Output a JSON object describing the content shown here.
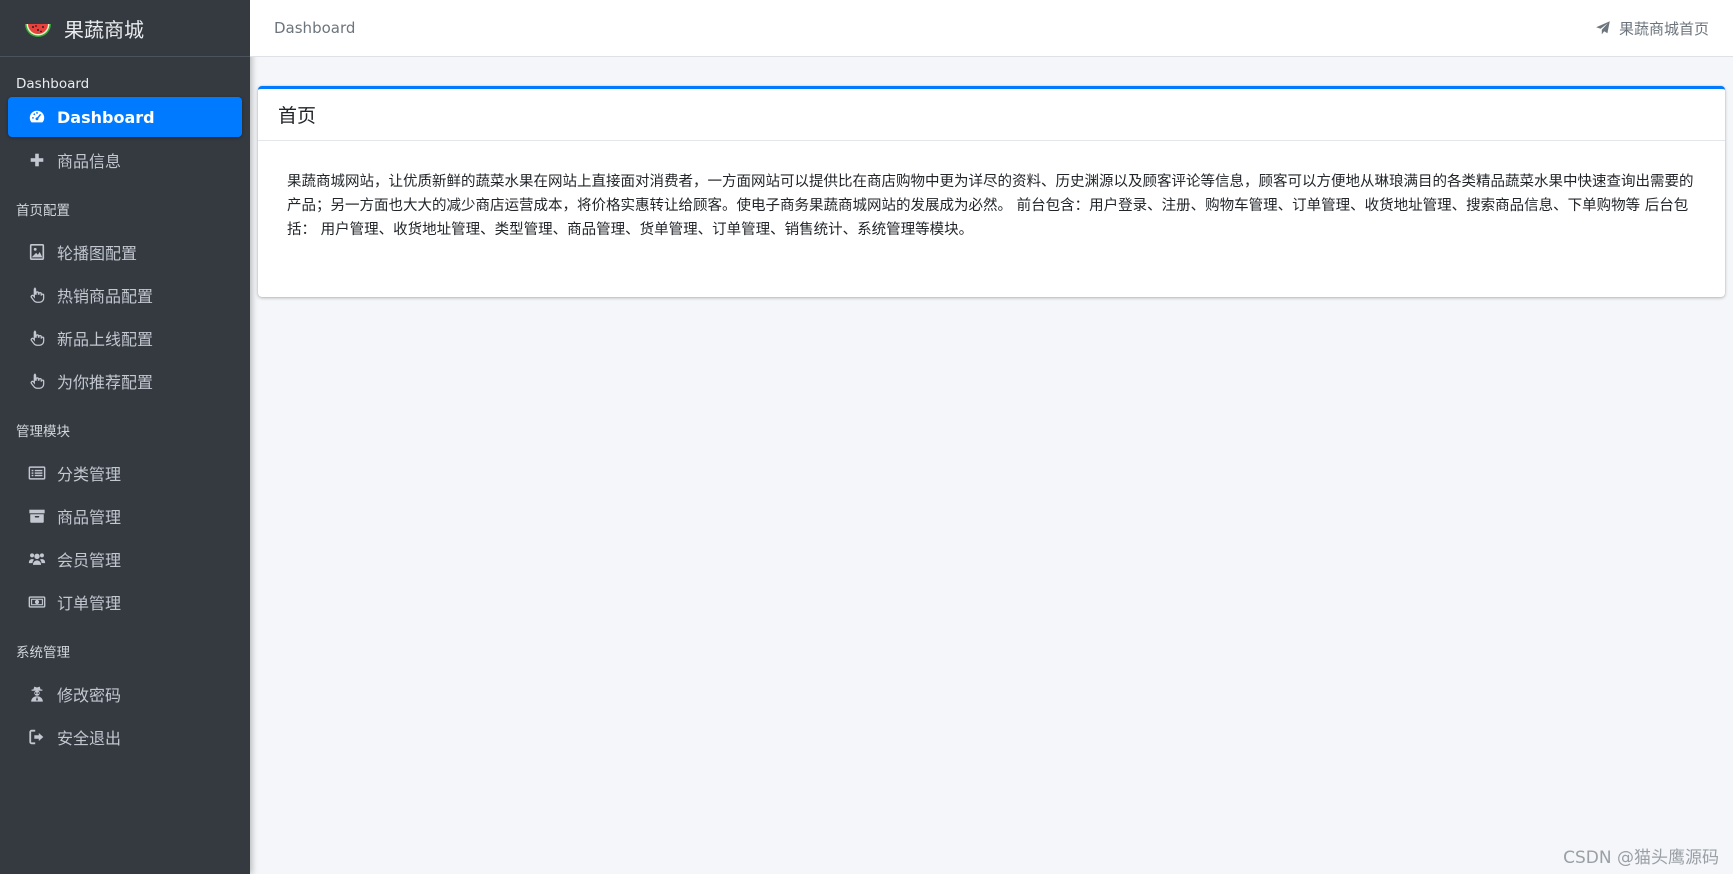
{
  "brand": {
    "name": "果蔬商城",
    "logo_icon": "watermelon-icon"
  },
  "sidebar": {
    "sections": [
      {
        "header": "Dashboard",
        "items": [
          {
            "label": "Dashboard",
            "icon": "dashboard-gauge-icon",
            "active": true
          },
          {
            "label": "商品信息",
            "icon": "plus-icon"
          }
        ]
      },
      {
        "header": "首页配置",
        "items": [
          {
            "label": "轮播图配置",
            "icon": "image-icon"
          },
          {
            "label": "热销商品配置",
            "icon": "hand-pointer-icon"
          },
          {
            "label": "新品上线配置",
            "icon": "hand-pointer-icon"
          },
          {
            "label": "为你推荐配置",
            "icon": "hand-pointer-icon"
          }
        ]
      },
      {
        "header": "管理模块",
        "items": [
          {
            "label": "分类管理",
            "icon": "list-alt-icon"
          },
          {
            "label": "商品管理",
            "icon": "archive-icon"
          },
          {
            "label": "会员管理",
            "icon": "users-icon"
          },
          {
            "label": "订单管理",
            "icon": "money-bill-icon"
          }
        ]
      },
      {
        "header": "系统管理",
        "items": [
          {
            "label": "修改密码",
            "icon": "user-secret-icon"
          },
          {
            "label": "安全退出",
            "icon": "sign-out-icon"
          }
        ]
      }
    ]
  },
  "topbar": {
    "breadcrumb": "Dashboard",
    "home_link": "果蔬商城首页",
    "home_icon": "paper-plane-icon"
  },
  "card": {
    "title": "首页",
    "body": "果蔬商城网站，让优质新鲜的蔬菜水果在网站上直接面对消费者，一方面网站可以提供比在商店购物中更为详尽的资料、历史渊源以及顾客评论等信息，顾客可以方便地从琳琅满目的各类精品蔬菜水果中快速查询出需要的产品；另一方面也大大的减少商店运营成本，将价格实惠转让给顾客。使电子商务果蔬商城网站的发展成为必然。 前台包含：用户登录、注册、购物车管理、订单管理、收货地址管理、搜索商品信息、下单购物等 后台包括： 用户管理、收货地址管理、类型管理、商品管理、货单管理、订单管理、销售统计、系统管理等模块。"
  },
  "watermark": "CSDN @猫头鹰源码",
  "colors": {
    "sidebar_bg": "#343a40",
    "accent": "#007bff",
    "content_bg": "#f4f6f9"
  }
}
